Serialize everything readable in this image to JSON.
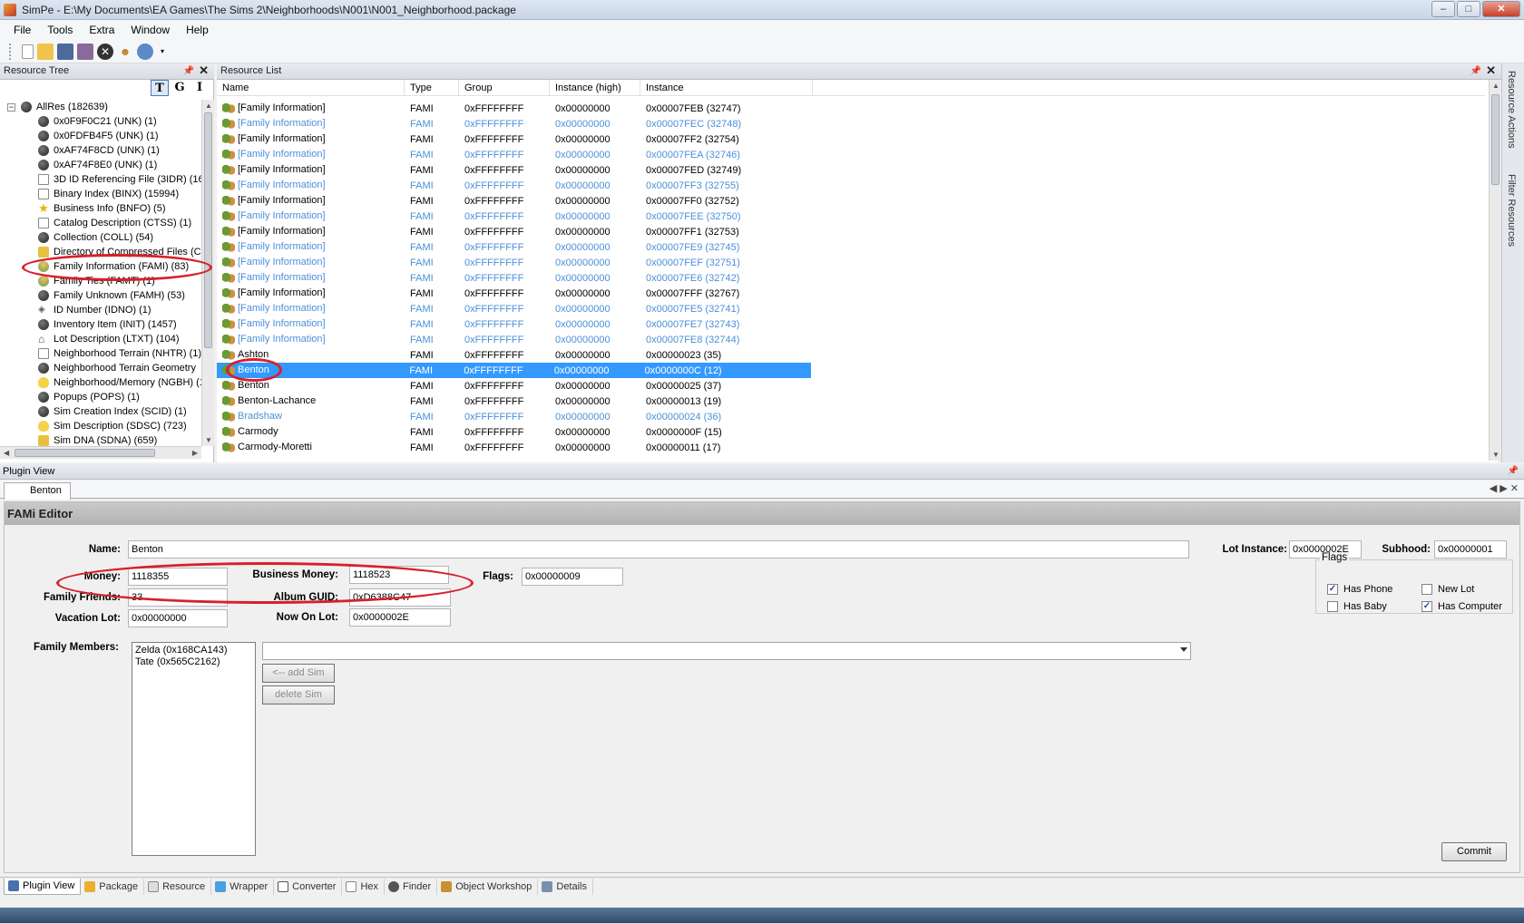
{
  "window": {
    "title": "SimPe - E:\\My Documents\\EA Games\\The Sims 2\\Neighborhoods\\N001\\N001_Neighborhood.package",
    "minimize": "–",
    "maximize": "□",
    "close": "✕"
  },
  "menu": [
    "File",
    "Tools",
    "Extra",
    "Window",
    "Help"
  ],
  "toolbar_icons": [
    "new-icon",
    "open-icon",
    "save-icon",
    "save-all-icon",
    "close-icon",
    "sims-icon",
    "settings-icon"
  ],
  "resource_tree": {
    "title": "Resource Tree",
    "tools": [
      "T",
      "G",
      "I"
    ],
    "root": "AllRes (182639)",
    "items": [
      {
        "label": "0x0F9F0C21 (UNK) (1)",
        "icon": "sphere-icon"
      },
      {
        "label": "0x0FDFB4F5 (UNK) (1)",
        "icon": "sphere-icon"
      },
      {
        "label": "0xAF74F8CD (UNK) (1)",
        "icon": "sphere-icon"
      },
      {
        "label": "0xAF74F8E0 (UNK) (1)",
        "icon": "sphere-icon"
      },
      {
        "label": "3D ID Referencing File (3IDR) (16",
        "icon": "image-icon"
      },
      {
        "label": "Binary Index (BINX) (15994)",
        "icon": "doc-icon"
      },
      {
        "label": "Business Info (BNFO) (5)",
        "icon": "star-icon"
      },
      {
        "label": "Catalog Description (CTSS) (1)",
        "icon": "doc-icon"
      },
      {
        "label": "Collection (COLL) (54)",
        "icon": "sphere-icon"
      },
      {
        "label": "Directory of Compressed Files (C",
        "icon": "folder-icon"
      },
      {
        "label": "Family Information (FAMI) (83)",
        "icon": "family-icon"
      },
      {
        "label": "Family Ties (FAMT) (1)",
        "icon": "family-icon"
      },
      {
        "label": "Family Unknown (FAMH) (53)",
        "icon": "sphere-icon"
      },
      {
        "label": "ID Number (IDNO) (1)",
        "icon": "id-icon"
      },
      {
        "label": "Inventory Item (INIT) (1457)",
        "icon": "sphere-icon"
      },
      {
        "label": "Lot Description (LTXT) (104)",
        "icon": "house-icon"
      },
      {
        "label": "Neighborhood Terrain (NHTR) (1)",
        "icon": "doc-icon"
      },
      {
        "label": "Neighborhood Terrain Geometry",
        "icon": "sphere-icon"
      },
      {
        "label": "Neighborhood/Memory (NGBH) (1",
        "icon": "bulb-icon"
      },
      {
        "label": "Popups (POPS) (1)",
        "icon": "sphere-icon"
      },
      {
        "label": "Sim Creation Index (SCID) (1)",
        "icon": "sphere-icon"
      },
      {
        "label": "Sim Description (SDSC) (723)",
        "icon": "person-icon"
      },
      {
        "label": "Sim DNA (SDNA) (659)",
        "icon": "folder-icon"
      }
    ]
  },
  "resource_list": {
    "title": "Resource List",
    "columns": [
      "Name",
      "Type",
      "Group",
      "Instance (high)",
      "Instance"
    ],
    "rows": [
      {
        "name": "[Family Information]",
        "type": "FAMI",
        "group": "0xFFFFFFFF",
        "ihigh": "0x00000000",
        "inst": "0x00007FEB (32747)",
        "style": "normal"
      },
      {
        "name": "[Family Information]",
        "type": "FAMI",
        "group": "0xFFFFFFFF",
        "ihigh": "0x00000000",
        "inst": "0x00007FEC (32748)",
        "style": "alt"
      },
      {
        "name": "[Family Information]",
        "type": "FAMI",
        "group": "0xFFFFFFFF",
        "ihigh": "0x00000000",
        "inst": "0x00007FF2 (32754)",
        "style": "normal"
      },
      {
        "name": "[Family Information]",
        "type": "FAMI",
        "group": "0xFFFFFFFF",
        "ihigh": "0x00000000",
        "inst": "0x00007FEA (32746)",
        "style": "alt"
      },
      {
        "name": "[Family Information]",
        "type": "FAMI",
        "group": "0xFFFFFFFF",
        "ihigh": "0x00000000",
        "inst": "0x00007FED (32749)",
        "style": "normal"
      },
      {
        "name": "[Family Information]",
        "type": "FAMI",
        "group": "0xFFFFFFFF",
        "ihigh": "0x00000000",
        "inst": "0x00007FF3 (32755)",
        "style": "alt"
      },
      {
        "name": "[Family Information]",
        "type": "FAMI",
        "group": "0xFFFFFFFF",
        "ihigh": "0x00000000",
        "inst": "0x00007FF0 (32752)",
        "style": "normal"
      },
      {
        "name": "[Family Information]",
        "type": "FAMI",
        "group": "0xFFFFFFFF",
        "ihigh": "0x00000000",
        "inst": "0x00007FEE (32750)",
        "style": "alt"
      },
      {
        "name": "[Family Information]",
        "type": "FAMI",
        "group": "0xFFFFFFFF",
        "ihigh": "0x00000000",
        "inst": "0x00007FF1 (32753)",
        "style": "normal"
      },
      {
        "name": "[Family Information]",
        "type": "FAMI",
        "group": "0xFFFFFFFF",
        "ihigh": "0x00000000",
        "inst": "0x00007FE9 (32745)",
        "style": "alt"
      },
      {
        "name": "[Family Information]",
        "type": "FAMI",
        "group": "0xFFFFFFFF",
        "ihigh": "0x00000000",
        "inst": "0x00007FEF (32751)",
        "style": "alt"
      },
      {
        "name": "[Family Information]",
        "type": "FAMI",
        "group": "0xFFFFFFFF",
        "ihigh": "0x00000000",
        "inst": "0x00007FE6 (32742)",
        "style": "alt"
      },
      {
        "name": "[Family Information]",
        "type": "FAMI",
        "group": "0xFFFFFFFF",
        "ihigh": "0x00000000",
        "inst": "0x00007FFF (32767)",
        "style": "normal"
      },
      {
        "name": "[Family Information]",
        "type": "FAMI",
        "group": "0xFFFFFFFF",
        "ihigh": "0x00000000",
        "inst": "0x00007FE5 (32741)",
        "style": "alt"
      },
      {
        "name": "[Family Information]",
        "type": "FAMI",
        "group": "0xFFFFFFFF",
        "ihigh": "0x00000000",
        "inst": "0x00007FE7 (32743)",
        "style": "alt"
      },
      {
        "name": "[Family Information]",
        "type": "FAMI",
        "group": "0xFFFFFFFF",
        "ihigh": "0x00000000",
        "inst": "0x00007FE8 (32744)",
        "style": "alt"
      },
      {
        "name": "Ashton",
        "type": "FAMI",
        "group": "0xFFFFFFFF",
        "ihigh": "0x00000000",
        "inst": "0x00000023 (35)",
        "style": "normal"
      },
      {
        "name": "Benton",
        "type": "FAMI",
        "group": "0xFFFFFFFF",
        "ihigh": "0x00000000",
        "inst": "0x0000000C (12)",
        "style": "sel"
      },
      {
        "name": "Benton",
        "type": "FAMI",
        "group": "0xFFFFFFFF",
        "ihigh": "0x00000000",
        "inst": "0x00000025 (37)",
        "style": "normal"
      },
      {
        "name": "Benton-Lachance",
        "type": "FAMI",
        "group": "0xFFFFFFFF",
        "ihigh": "0x00000000",
        "inst": "0x00000013 (19)",
        "style": "normal"
      },
      {
        "name": "Bradshaw",
        "type": "FAMI",
        "group": "0xFFFFFFFF",
        "ihigh": "0x00000000",
        "inst": "0x00000024 (36)",
        "style": "alt"
      },
      {
        "name": "Carmody",
        "type": "FAMI",
        "group": "0xFFFFFFFF",
        "ihigh": "0x00000000",
        "inst": "0x0000000F (15)",
        "style": "normal"
      },
      {
        "name": "Carmody-Moretti",
        "type": "FAMI",
        "group": "0xFFFFFFFF",
        "ihigh": "0x00000000",
        "inst": "0x00000011 (17)",
        "style": "normal"
      }
    ]
  },
  "side_dock": [
    "Resource Actions",
    "Filter Resources"
  ],
  "plugin_view": {
    "title": "Plugin View",
    "tab": "Benton",
    "editor_title": "FAMi Editor",
    "labels": {
      "name": "Name:",
      "lot_instance": "Lot Instance:",
      "subhood": "Subhood:",
      "money": "Money:",
      "business_money": "Business Money:",
      "flags": "Flags:",
      "family_friends": "Family Friends:",
      "album_guid": "Album GUID:",
      "vacation_lot": "Vacation Lot:",
      "now_on_lot": "Now On Lot:",
      "family_members": "Family Members:"
    },
    "values": {
      "name": "Benton",
      "lot_instance": "0x0000002E",
      "subhood": "0x00000001",
      "money": "1118355",
      "business_money": "1118523",
      "flags": "0x00000009",
      "family_friends": "33",
      "album_guid": "0xD6388C47",
      "vacation_lot": "0x00000000",
      "now_on_lot": "0x0000002E"
    },
    "members": [
      "Zelda (0x168CA143)",
      "Tate (0x565C2162)"
    ],
    "flags_group": {
      "title": "Flags",
      "items": [
        {
          "label": "Has Phone",
          "checked": true
        },
        {
          "label": "New Lot",
          "checked": false
        },
        {
          "label": "Has Baby",
          "checked": false
        },
        {
          "label": "Has Computer",
          "checked": true
        }
      ]
    },
    "buttons": {
      "add_sim": "<-- add Sim",
      "delete_sim": "delete Sim",
      "commit": "Commit"
    }
  },
  "bottom_tabs": [
    "Plugin View",
    "Package",
    "Resource",
    "Wrapper",
    "Converter",
    "Hex",
    "Finder",
    "Object Workshop",
    "Details"
  ]
}
